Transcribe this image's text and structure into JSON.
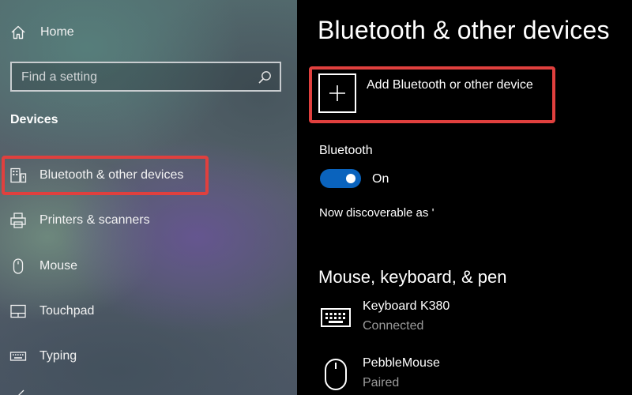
{
  "sidebar": {
    "home_label": "Home",
    "search_placeholder": "Find a setting",
    "section_heading": "Devices",
    "items": [
      {
        "label": "Bluetooth & other devices",
        "icon": "bluetooth-devices-icon",
        "selected": true
      },
      {
        "label": "Printers & scanners",
        "icon": "printer-icon"
      },
      {
        "label": "Mouse",
        "icon": "mouse-icon"
      },
      {
        "label": "Touchpad",
        "icon": "touchpad-icon"
      },
      {
        "label": "Typing",
        "icon": "keyboard-icon"
      }
    ]
  },
  "main": {
    "title": "Bluetooth & other devices",
    "add_device_label": "Add Bluetooth or other device",
    "bluetooth_label": "Bluetooth",
    "bluetooth_state": "On",
    "discoverable_text": "Now discoverable as '",
    "section_title": "Mouse, keyboard, & pen",
    "devices": [
      {
        "name": "Keyboard K380",
        "status": "Connected",
        "icon": "keyboard-icon"
      },
      {
        "name": "PebbleMouse",
        "status": "Paired",
        "icon": "mouse-icon"
      }
    ]
  },
  "colors": {
    "highlight": "#e0403e",
    "toggle_on": "#0a63bd",
    "status_text": "#9a9a9a"
  }
}
